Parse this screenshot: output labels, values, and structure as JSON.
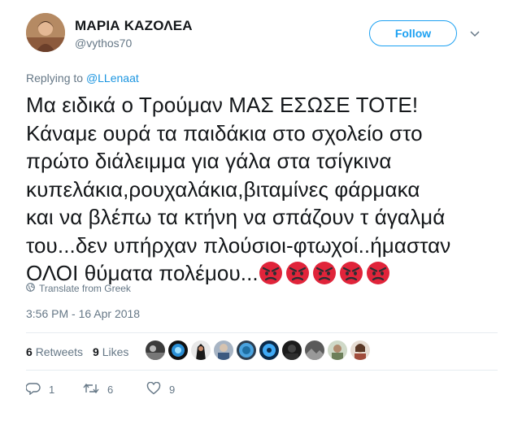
{
  "author": {
    "name": "ΜΑΡΙΑ ΚΑΖΟΛΕΑ",
    "handle": "@vythos70"
  },
  "follow_label": "Follow",
  "reply": {
    "prefix": "Replying to",
    "to": "@LLenaat"
  },
  "tweet_lines": [
    "Μα ειδικά ο Τρούμαν ΜΑΣ ΕΣΩΣΕ ΤΟΤΕ!",
    "Κάναμε ουρά τα παιδάκια στο σχολείο στο",
    "πρώτο διάλειμμα για γάλα στα τσίγκινα",
    "κυπελάκια,ρουχαλάκια,βιταμίνες φάρμακα",
    "και να βλέπω τα κτήνη να σπάζουν τ άγαλμά",
    "του...δεν υπήρχαν πλούσιοι-φτωχοί..ήμασταν",
    "ΟΛΟΙ θύματα πολέμου..."
  ],
  "emoji_count": 5,
  "emoji": "angry-face-icon",
  "translate_label": "Translate from Greek",
  "timestamp": "3:56 PM - 16 Apr 2018",
  "stats": {
    "retweets_count": "6",
    "retweets_label": "Retweets",
    "likes_count": "9",
    "likes_label": "Likes"
  },
  "actions": {
    "replies": "1",
    "retweets": "6",
    "likes": "9"
  },
  "colors": {
    "accent": "#1da1f2",
    "muted": "#657786",
    "text": "#14171a",
    "emoji_red": "#e0243a"
  }
}
